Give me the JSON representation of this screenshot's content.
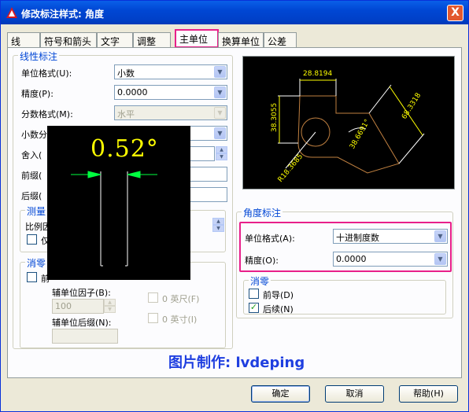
{
  "window": {
    "title": "修改标注样式: 角度",
    "close_label": "X"
  },
  "tabs": [
    {
      "label": "线"
    },
    {
      "label": "符号和箭头"
    },
    {
      "label": "文字"
    },
    {
      "label": "调整"
    },
    {
      "label": "主单位"
    },
    {
      "label": "换算单位"
    },
    {
      "label": "公差"
    }
  ],
  "linear": {
    "group_title": "线性标注",
    "unit_format_label": "单位格式(U):",
    "unit_format_value": "小数",
    "precision_label": "精度(P):",
    "precision_value": "0.0000",
    "fraction_label": "分数格式(M):",
    "fraction_value": "水平",
    "decimal_sep_label": "小数分",
    "round_label": "舍入(",
    "prefix_label": "前缀(",
    "suffix_label": "后缀("
  },
  "measure": {
    "group_title": "测量",
    "scale_label": "比例因",
    "only_layout_label": "仅"
  },
  "zero_left": {
    "group_title": "消零",
    "leading_label": "前",
    "sub_unit_factor_label": "辅单位因子(B):",
    "sub_unit_factor_value": "100",
    "feet_label": "0 英尺(F)",
    "inches_label": "0 英寸(I)",
    "sub_unit_suffix_label": "辅单位后缀(N):"
  },
  "angular": {
    "group_title": "角度标注",
    "unit_format_label": "单位格式(A):",
    "unit_format_value": "十进制度数",
    "precision_label": "精度(O):",
    "precision_value": "0.0000"
  },
  "zero_right": {
    "group_title": "消零",
    "leading_label": "前导(D)",
    "trailing_label": "后续(N)",
    "trailing_checked": "✓"
  },
  "preview": {
    "dim_top": "28.8194",
    "dim_left": "38.3055",
    "dim_right": "68.3318",
    "dim_angle": "38.6691°",
    "dim_radius": "R18.3685"
  },
  "overlay": {
    "value": "0.52°"
  },
  "credit": "图片制作: lvdeping",
  "buttons": {
    "ok": "确定",
    "cancel": "取消",
    "help": "帮助(H)"
  },
  "colors": {
    "accent": "#0046d5",
    "highlight": "#e8208a",
    "preview_dim": "#ffff00",
    "preview_geom": "#c08040"
  }
}
